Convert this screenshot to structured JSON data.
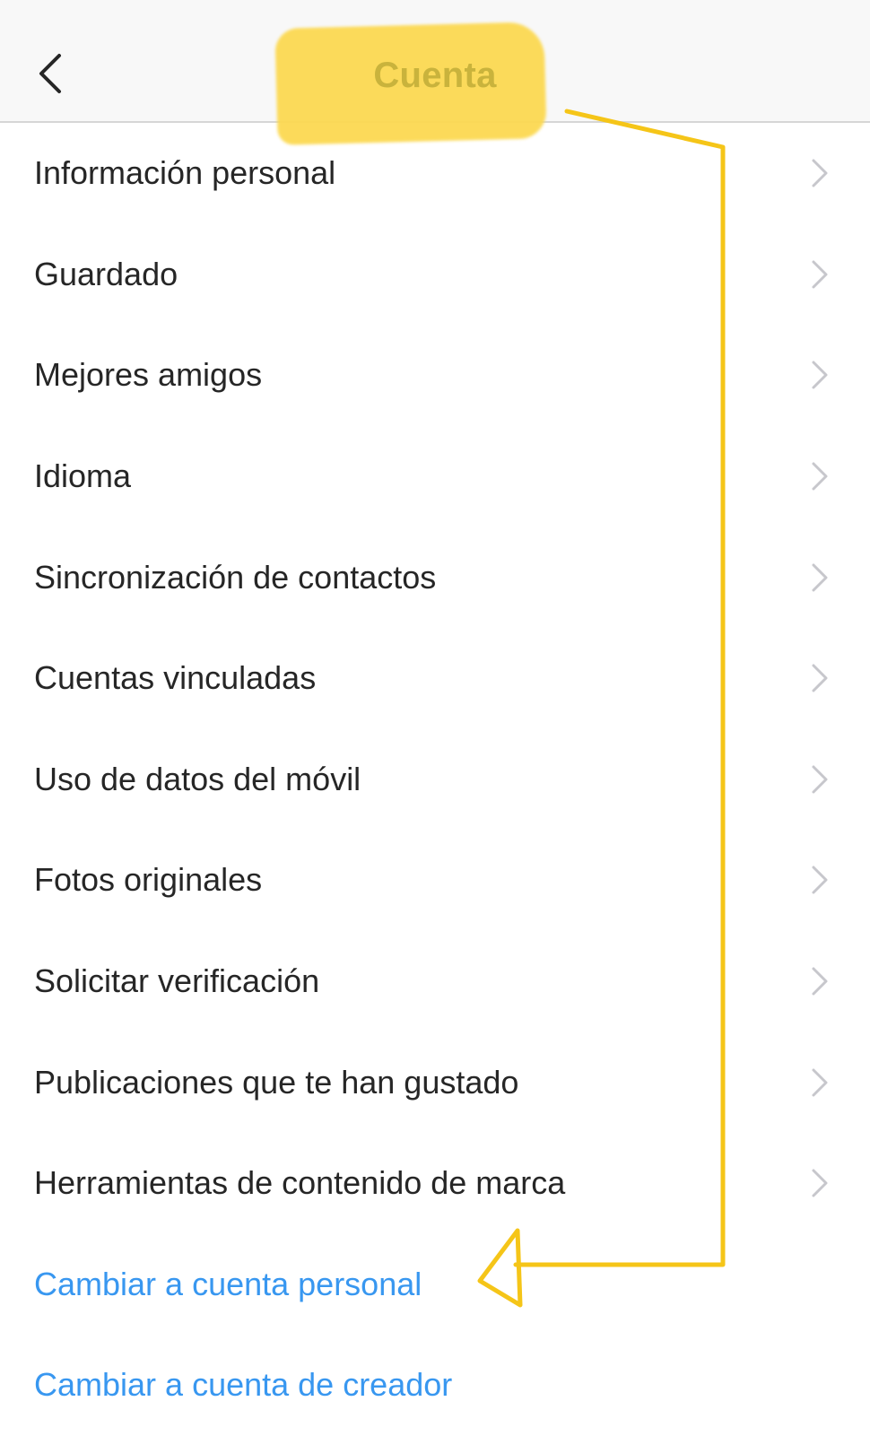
{
  "header": {
    "title": "Cuenta",
    "back_icon": "chevron-left-icon"
  },
  "items": [
    {
      "label": "Información personal",
      "icon": "chevron-right-icon"
    },
    {
      "label": "Guardado",
      "icon": "chevron-right-icon"
    },
    {
      "label": "Mejores amigos",
      "icon": "chevron-right-icon"
    },
    {
      "label": "Idioma",
      "icon": "chevron-right-icon"
    },
    {
      "label": "Sincronización de contactos",
      "icon": "chevron-right-icon"
    },
    {
      "label": "Cuentas vinculadas",
      "icon": "chevron-right-icon"
    },
    {
      "label": "Uso de datos del móvil",
      "icon": "chevron-right-icon"
    },
    {
      "label": "Fotos originales",
      "icon": "chevron-right-icon"
    },
    {
      "label": "Solicitar verificación",
      "icon": "chevron-right-icon"
    },
    {
      "label": "Publicaciones que te han gustado",
      "icon": "chevron-right-icon"
    },
    {
      "label": "Herramientas de contenido de marca",
      "icon": "chevron-right-icon"
    }
  ],
  "links": [
    {
      "label": "Cambiar a cuenta personal"
    },
    {
      "label": "Cambiar a cuenta de creador"
    }
  ],
  "colors": {
    "text": "#262626",
    "link": "#3897f0",
    "chevron": "#c7c7cc",
    "highlight": "#fcd952",
    "annotation": "#f5c518"
  }
}
